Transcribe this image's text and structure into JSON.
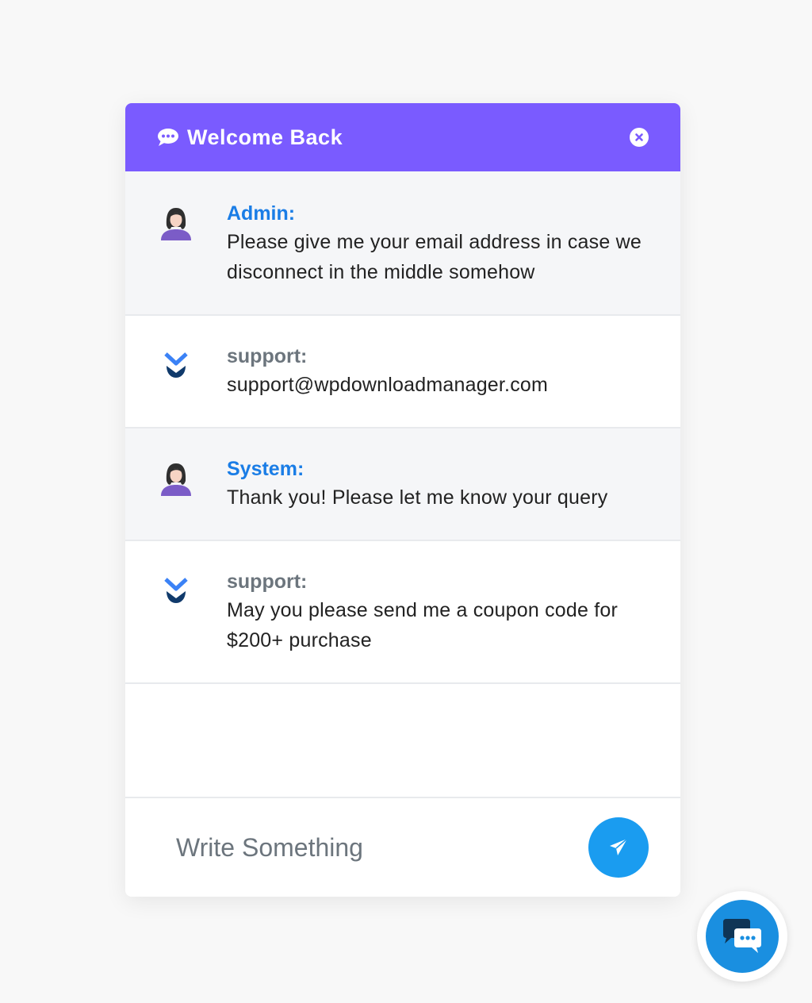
{
  "colors": {
    "header": "#7a5bff",
    "sender_blue": "#1a7de6",
    "sender_gray": "#6c757d",
    "send_button": "#1a9cf0",
    "launcher": "#1a8fe0"
  },
  "header": {
    "title": "Welcome Back",
    "icon": "chat-bubble-icon",
    "close_icon": "close-circle-icon"
  },
  "messages": [
    {
      "sender": "Admin:",
      "text": "Please give me your email address in case we disconnect in the middle somehow",
      "avatar": "female-agent-avatar"
    },
    {
      "sender": "support:",
      "text": "support@wpdownloadmanager.com",
      "avatar": "wpdm-logo-avatar"
    },
    {
      "sender": "System:",
      "text": "Thank you! Please let me know your query",
      "avatar": "female-agent-avatar"
    },
    {
      "sender": "support:",
      "text": "May you please send me a coupon code for $200+ purchase",
      "avatar": "wpdm-logo-avatar"
    }
  ],
  "composer": {
    "placeholder": "Write Something",
    "send_icon": "paper-plane-icon"
  },
  "launcher": {
    "icon": "chat-dots-icon"
  }
}
